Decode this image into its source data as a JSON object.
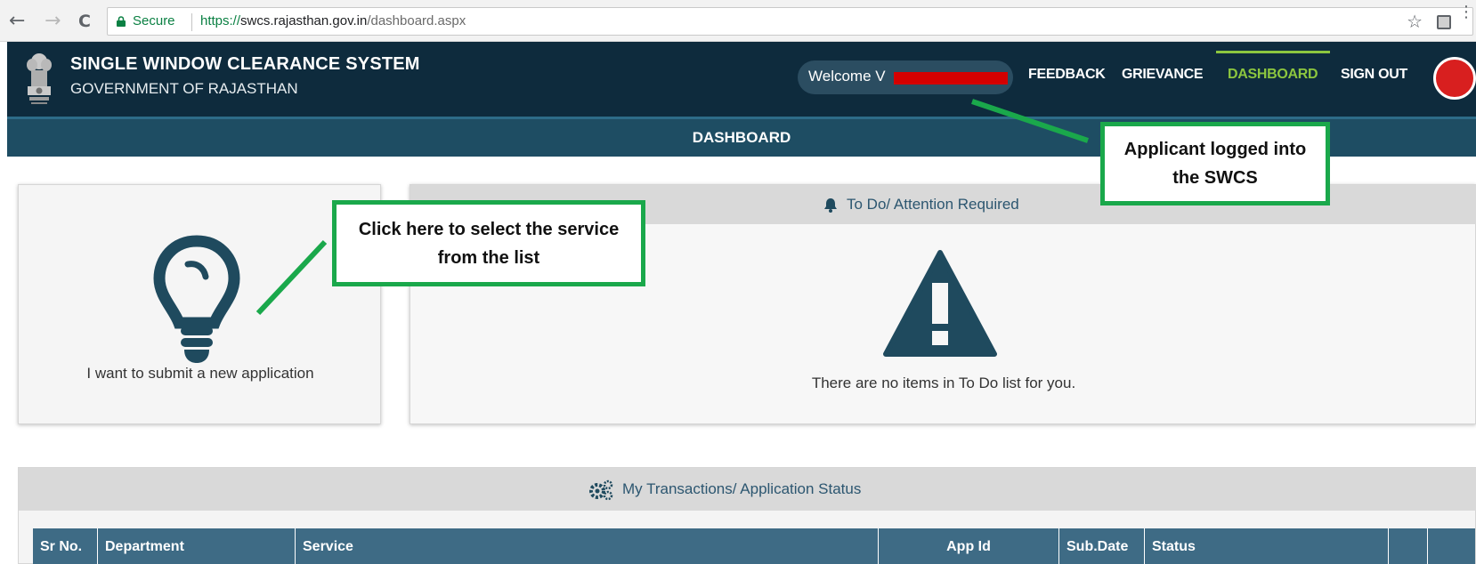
{
  "browser": {
    "nav_back": "←",
    "nav_forward": "→",
    "nav_reload": "C",
    "secure_label": "Secure",
    "url_scheme": "https://",
    "url_host": "swcs.rajasthan.gov.in",
    "url_path": "/dashboard.aspx",
    "star_glyph": "☆",
    "menu_glyph": "⋮",
    "icons": [
      "back-arrow-icon",
      "forward-arrow-icon",
      "reload-icon",
      "lock-icon",
      "star-icon",
      "extension-icon",
      "menu-icon"
    ]
  },
  "header": {
    "title": "SINGLE WINDOW CLEARANCE SYSTEM",
    "subtitle": "GOVERNMENT OF RAJASTHAN",
    "welcome": "Welcome V",
    "nav": [
      {
        "label": "FEEDBACK",
        "active": false
      },
      {
        "label": "GRIEVANCE",
        "active": false
      },
      {
        "label": "DASHBOARD",
        "active": true
      },
      {
        "label": "SIGN OUT",
        "active": false
      }
    ],
    "icons": [
      "state-emblem-icon",
      "avatar"
    ]
  },
  "dashboard_bar": {
    "title": "DASHBOARD"
  },
  "new_application": {
    "label": "I want to submit a new application",
    "icon": "lightbulb-icon"
  },
  "todo": {
    "title": "To Do/ Attention Required",
    "empty_message": "There are no items in To Do list for you.",
    "icons": [
      "bell-icon",
      "warning-icon"
    ]
  },
  "transactions": {
    "title": "My Transactions/ Application Status",
    "icon": "gears-icon",
    "columns": [
      "Sr No.",
      "Department",
      "Service",
      "App Id",
      "Sub.Date",
      "Status",
      "",
      ""
    ]
  },
  "annotations": {
    "logged_in": "Applicant logged into the SWCS",
    "select_service": "Click here to select the service from the list"
  },
  "colors": {
    "header_bg": "#0e2b3d",
    "dashboard_bar_bg": "#1e4d63",
    "table_header_bg": "#3e6b85",
    "active_nav": "#8cc63f",
    "annotation_green": "#1aa84b",
    "icon_dark": "#1f4a5e",
    "redaction": "#d40000"
  }
}
